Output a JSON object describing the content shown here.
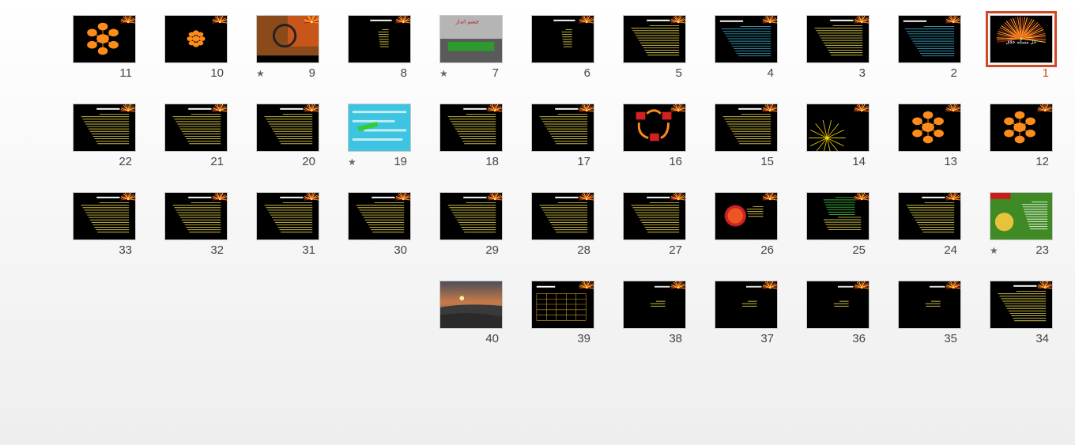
{
  "app": {
    "view": "Slide Sorter",
    "selected_slide": "1"
  },
  "colors": {
    "selection": "#d24726",
    "thumb_bg": "#000000",
    "accent_orange": "#ff8c1a",
    "accent_red": "#c0141a",
    "text_yellow": "#e8d84a"
  },
  "slides": [
    {
      "number": "1",
      "kind": "firework-title",
      "title": "حل مسئله خلاق",
      "selected": true,
      "transition": false
    },
    {
      "number": "2",
      "kind": "text-cyan",
      "title": "",
      "selected": false,
      "transition": false
    },
    {
      "number": "3",
      "kind": "text-yellow",
      "title": "(Business Plan) طرح تجاری",
      "selected": false,
      "transition": false
    },
    {
      "number": "4",
      "kind": "text-cyan",
      "title": "مزایای طرح تجاری",
      "selected": false,
      "transition": false
    },
    {
      "number": "5",
      "kind": "text-yellow",
      "title": "طرح تجاری برای چه شخصی",
      "selected": false,
      "transition": false
    },
    {
      "number": "6",
      "kind": "bullets",
      "title": "اجزای طرح تجاری",
      "selected": false,
      "transition": false
    },
    {
      "number": "7",
      "kind": "photo-gray",
      "title": "چشم انداز",
      "selected": false,
      "transition": true
    },
    {
      "number": "8",
      "kind": "bullets",
      "title": "سوالات تحریک کننده ذهن",
      "selected": false,
      "transition": false
    },
    {
      "number": "9",
      "kind": "photo-autumn",
      "title": "",
      "selected": false,
      "transition": true
    },
    {
      "number": "10",
      "kind": "flower",
      "title": "",
      "selected": false,
      "transition": false
    },
    {
      "number": "11",
      "kind": "mindmap",
      "title": "",
      "selected": false,
      "transition": false
    },
    {
      "number": "12",
      "kind": "mindmap",
      "title": "",
      "selected": false,
      "transition": false
    },
    {
      "number": "13",
      "kind": "mindmap",
      "title": "",
      "selected": false,
      "transition": false
    },
    {
      "number": "14",
      "kind": "burst",
      "title": "",
      "selected": false,
      "transition": false
    },
    {
      "number": "15",
      "kind": "text-yellow",
      "title": "",
      "selected": false,
      "transition": false
    },
    {
      "number": "16",
      "kind": "cycle",
      "title": "",
      "selected": false,
      "transition": false
    },
    {
      "number": "17",
      "kind": "text-yellow",
      "title": "",
      "selected": false,
      "transition": false
    },
    {
      "number": "18",
      "kind": "text-yellow",
      "title": "",
      "selected": false,
      "transition": false
    },
    {
      "number": "19",
      "kind": "photo-maze",
      "title": "",
      "selected": false,
      "transition": true
    },
    {
      "number": "20",
      "kind": "text-yellow",
      "title": "",
      "selected": false,
      "transition": false
    },
    {
      "number": "21",
      "kind": "text-yellow",
      "title": "",
      "selected": false,
      "transition": false
    },
    {
      "number": "22",
      "kind": "text-yellow",
      "title": "",
      "selected": false,
      "transition": false
    },
    {
      "number": "23",
      "kind": "photo-scamper",
      "title": "SCAMPER",
      "selected": false,
      "transition": true
    },
    {
      "number": "24",
      "kind": "text-yellow",
      "title": "SCAMPER",
      "selected": false,
      "transition": false
    },
    {
      "number": "25",
      "kind": "text-green",
      "title": "",
      "selected": false,
      "transition": false
    },
    {
      "number": "26",
      "kind": "ball",
      "title": "",
      "selected": false,
      "transition": false
    },
    {
      "number": "27",
      "kind": "text-yellow",
      "title": "ماموریت",
      "selected": false,
      "transition": false
    },
    {
      "number": "28",
      "kind": "text-yellow",
      "title": "",
      "selected": false,
      "transition": false
    },
    {
      "number": "29",
      "kind": "text-yellow",
      "title": "اهداف",
      "selected": false,
      "transition": false
    },
    {
      "number": "30",
      "kind": "text-yellow",
      "title": "",
      "selected": false,
      "transition": false
    },
    {
      "number": "31",
      "kind": "text-yellow",
      "title": "",
      "selected": false,
      "transition": false
    },
    {
      "number": "32",
      "kind": "text-yellow",
      "title": "",
      "selected": false,
      "transition": false
    },
    {
      "number": "33",
      "kind": "text-yellow",
      "title": "",
      "selected": false,
      "transition": false
    },
    {
      "number": "34",
      "kind": "text-yellow",
      "title": "",
      "selected": false,
      "transition": false
    },
    {
      "number": "35",
      "kind": "sparse",
      "title": "",
      "selected": false,
      "transition": false
    },
    {
      "number": "36",
      "kind": "sparse",
      "title": "",
      "selected": false,
      "transition": false
    },
    {
      "number": "37",
      "kind": "sparse",
      "title": "",
      "selected": false,
      "transition": false
    },
    {
      "number": "38",
      "kind": "sparse",
      "title": "",
      "selected": false,
      "transition": false
    },
    {
      "number": "39",
      "kind": "grid-table",
      "title": "",
      "selected": false,
      "transition": false
    },
    {
      "number": "40",
      "kind": "photo-sunset",
      "title": "",
      "selected": false,
      "transition": false
    }
  ],
  "transition_icon": "★"
}
